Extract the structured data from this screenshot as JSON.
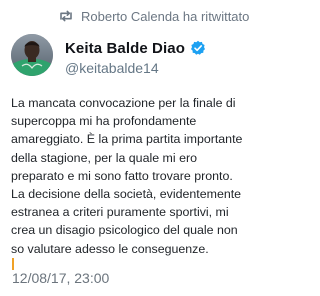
{
  "retweet": {
    "icon": "retweet-icon",
    "text": "Roberto Calenda ha ritwittato"
  },
  "author": {
    "display_name": "Keita Balde Diao",
    "handle": "@keitabalde14",
    "verified_icon": "verified-badge-icon",
    "verified_color": "#1da1f2"
  },
  "tweet": {
    "lines": [
      "La mancata convocazione per la finale di",
      "supercoppa mi ha profondamente",
      "amareggiato. È la prima partita importante",
      "della stagione, per la quale mi ero",
      "preparato e mi sono fatto trovare pronto.",
      "La decisione della società, evidentemente",
      "estranea a criteri puramente sportivi, mi",
      "crea un disagio psicologico del quale non",
      "so valutare adesso le conseguenze."
    ]
  },
  "timestamp": "12/08/17, 23:00"
}
